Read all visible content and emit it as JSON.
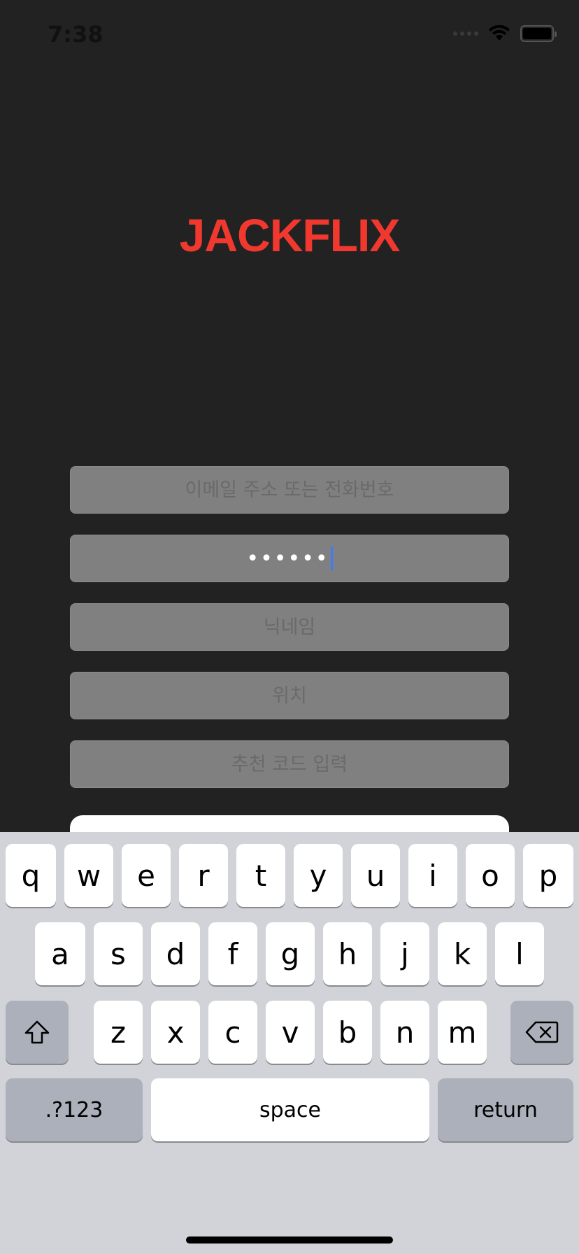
{
  "status_bar": {
    "time": "7:38"
  },
  "app": {
    "logo": "JACKFLIX"
  },
  "form": {
    "email_placeholder": "이메일 주소 또는 전화번호",
    "password_masked": "••••••",
    "nickname_placeholder": "닉네임",
    "location_placeholder": "위치",
    "referral_placeholder": "추천 코드 입력"
  },
  "keyboard": {
    "row1": [
      "q",
      "w",
      "e",
      "r",
      "t",
      "y",
      "u",
      "i",
      "o",
      "p"
    ],
    "row2": [
      "a",
      "s",
      "d",
      "f",
      "g",
      "h",
      "j",
      "k",
      "l"
    ],
    "row3": [
      "z",
      "x",
      "c",
      "v",
      "b",
      "n",
      "m"
    ],
    "numbers_label": ".?123",
    "space_label": "space",
    "return_label": "return"
  },
  "icons": {
    "shift": "shift-icon",
    "backspace": "backspace-icon",
    "wifi": "wifi-icon",
    "battery": "battery-icon"
  }
}
